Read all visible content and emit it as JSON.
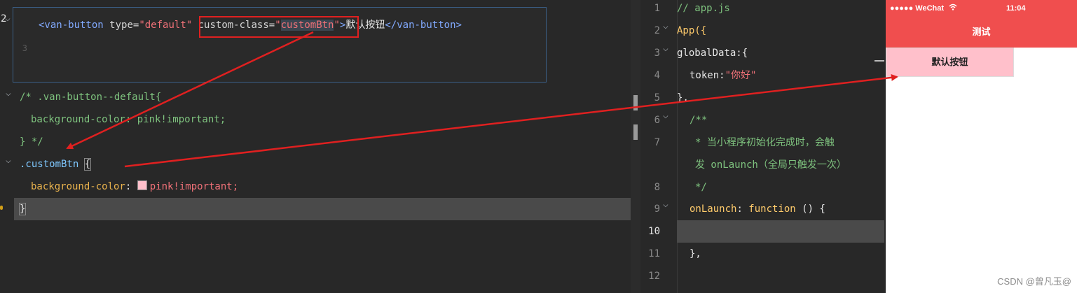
{
  "left_editor": {
    "snippet": {
      "line2_number": "2",
      "line3_number": "3",
      "code": {
        "open_tag": "<van-button",
        "attr_type": "type=",
        "type_value": "\"default\"",
        "attr_custom_class": "custom-class=",
        "quote_open": "\"",
        "custom_class_value": "customBtn",
        "quote_close": "\"",
        "gt": ">",
        "button_text": "默认按钮",
        "close_tag": "</van-button>"
      }
    },
    "css": {
      "comment_open": "/* .van-button--default{",
      "comment_body": "background-color: pink!important;",
      "comment_close": "} */",
      "selector": ".customBtn",
      "brace_open": "{",
      "property": "background-color",
      "colon": ": ",
      "value": "pink!important;",
      "brace_close": "}"
    }
  },
  "right_editor": {
    "lines": [
      {
        "num": "1",
        "text": "// app.js"
      },
      {
        "num": "2",
        "text": "App({"
      },
      {
        "num": "3",
        "text": "globalData:{"
      },
      {
        "num": "4",
        "key": "token:",
        "value": "\"你好\""
      },
      {
        "num": "5",
        "text": "},"
      },
      {
        "num": "6",
        "text": "/**"
      },
      {
        "num": "7",
        "text": "* 当小程序初始化完成时，会触"
      },
      {
        "num": "",
        "text": "发 onLaunch（全局只触发一次）"
      },
      {
        "num": "8",
        "text": "*/"
      },
      {
        "num": "9",
        "name": "onLaunch",
        "colon": ": ",
        "kw": "function",
        "rest": " () {"
      },
      {
        "num": "10",
        "text": ""
      },
      {
        "num": "11",
        "text": "},"
      },
      {
        "num": "12",
        "text": ""
      }
    ]
  },
  "phone": {
    "signal": "●●●●● WeChat",
    "time": "11:04",
    "nav_title": "测试",
    "button_label": "默认按钮",
    "watermark": "CSDN @曾凡玉@"
  },
  "colors": {
    "nav_red": "#f04e4e",
    "button_pink": "#ffc0cb",
    "annotation_red": "#e02020"
  }
}
